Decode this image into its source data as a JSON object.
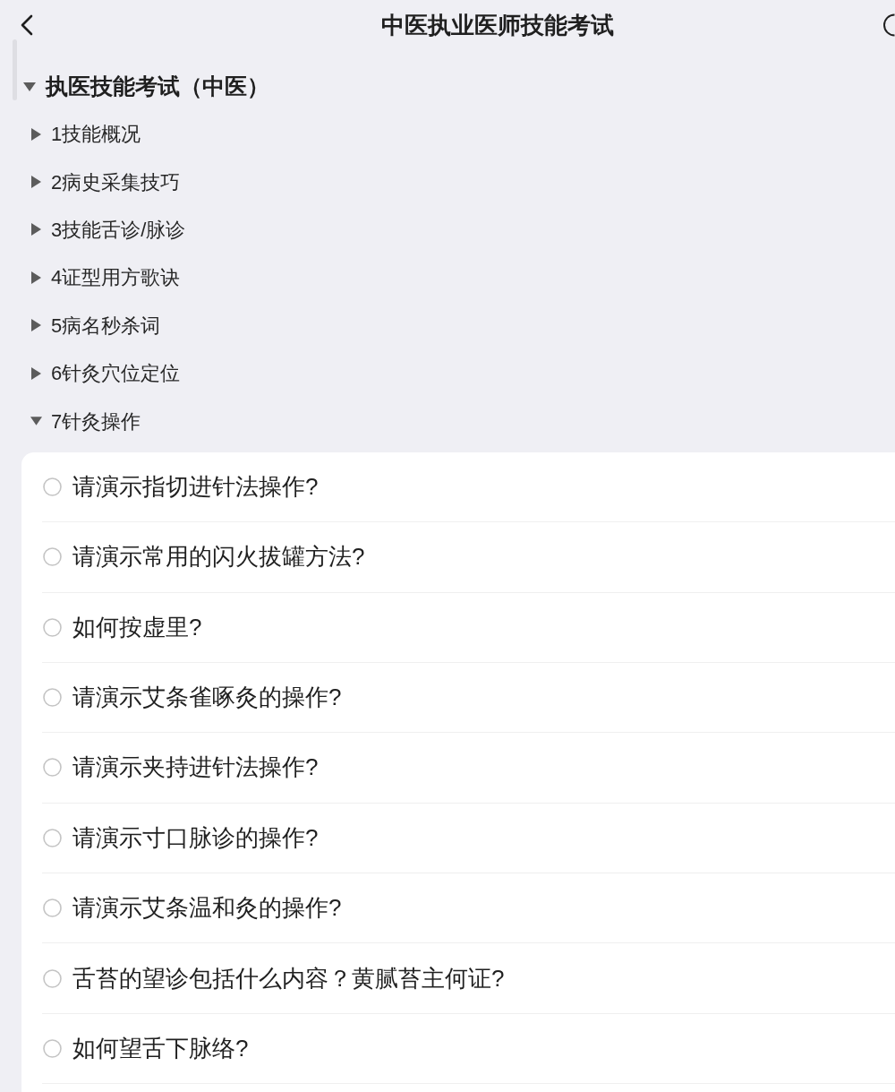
{
  "nav": {
    "title": "中医执业医师技能考试"
  },
  "tree": [
    {
      "kind": "heading",
      "label": "执医技能考试（中医）",
      "expanded": true,
      "children": [
        {
          "kind": "section",
          "label": "1技能概况",
          "expanded": false
        },
        {
          "kind": "section",
          "label": "2病史采集技巧",
          "expanded": false
        },
        {
          "kind": "section",
          "label": "3技能舌诊/脉诊",
          "expanded": false
        },
        {
          "kind": "section",
          "label": "4证型用方歌诀",
          "expanded": false
        },
        {
          "kind": "section",
          "label": "5病名秒杀词",
          "expanded": false
        },
        {
          "kind": "section",
          "label": "6针灸穴位定位",
          "expanded": false
        },
        {
          "kind": "section",
          "label": "7针灸操作",
          "expanded": true,
          "children": [
            {
              "kind": "question",
              "label": "请演示指切进针法操作?",
              "selected": false
            },
            {
              "kind": "question",
              "label": "请演示常用的闪火拔罐方法?",
              "selected": false
            },
            {
              "kind": "question",
              "label": "如何按虚里?",
              "selected": false
            },
            {
              "kind": "question",
              "label": "请演示艾条雀啄灸的操作?",
              "selected": false
            },
            {
              "kind": "question",
              "label": "请演示夹持进针法操作?",
              "selected": false
            },
            {
              "kind": "question",
              "label": "请演示寸口脉诊的操作?",
              "selected": false
            },
            {
              "kind": "question",
              "label": "请演示艾条温和灸的操作?",
              "selected": false
            },
            {
              "kind": "question",
              "label": "舌苔的望诊包括什么内容？黄腻苔主何证?",
              "selected": false
            },
            {
              "kind": "question",
              "label": "如何望舌下脉络?",
              "selected": false
            }
          ]
        }
      ]
    }
  ]
}
